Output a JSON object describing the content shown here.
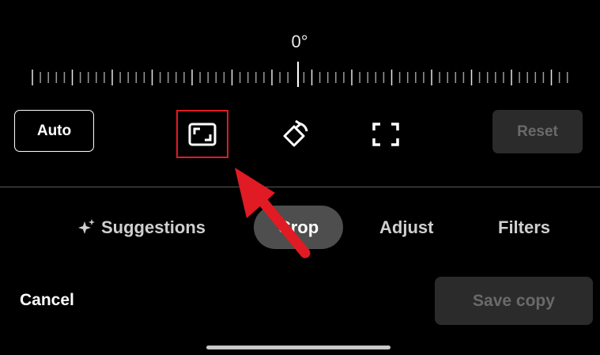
{
  "rotation": {
    "angle_label": "0°"
  },
  "toolbar": {
    "auto_label": "Auto",
    "reset_label": "Reset",
    "icons": [
      "aspect-ratio-icon",
      "rotate-icon",
      "free-crop-icon"
    ]
  },
  "tabs": [
    {
      "label": "Suggestions",
      "icon": "sparkle-icon",
      "active": false
    },
    {
      "label": "Crop",
      "active": true
    },
    {
      "label": "Adjust",
      "active": false
    },
    {
      "label": "Filters",
      "active": false
    }
  ],
  "footer": {
    "cancel_label": "Cancel",
    "save_label": "Save copy"
  },
  "colors": {
    "background": "#000000",
    "highlight": "#e01b24",
    "active_tab": "#4e4e4e",
    "disabled_button": "#2b2b2b",
    "disabled_text": "#6a6a6a"
  }
}
